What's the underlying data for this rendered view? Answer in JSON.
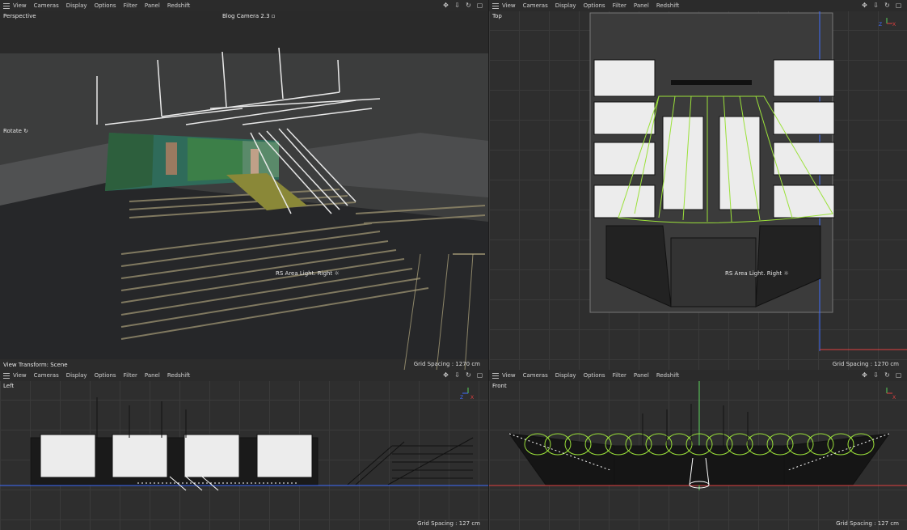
{
  "menu": [
    "View",
    "Cameras",
    "Display",
    "Options",
    "Filter",
    "Panel",
    "Redshift"
  ],
  "nav_icons": [
    "move-icon",
    "pan-icon",
    "rotate-icon",
    "maximize-icon"
  ],
  "axis_labels": {
    "z": "Z",
    "x": "X",
    "y": "Y"
  },
  "viewports": {
    "perspective": {
      "label": "Perspective",
      "camera": "Blog Camera 2.3",
      "rotate": "Rotate",
      "light_label": "RS Area Light. Right",
      "view_transform": "View Transform: Scene",
      "grid_spacing": "Grid Spacing : 1270 cm"
    },
    "top": {
      "label": "Top",
      "light_label": "RS Area Light. Right",
      "grid_spacing": "Grid Spacing : 1270 cm"
    },
    "left": {
      "label": "Left",
      "grid_spacing": "Grid Spacing : 127 cm"
    },
    "front": {
      "label": "Front",
      "grid_spacing": "Grid Spacing : 127 cm"
    }
  },
  "colors": {
    "background": "#262626",
    "wire": "#ffffff",
    "light_green": "#9be13a",
    "axis_x": "#e04040",
    "axis_y": "#5ad15a",
    "axis_z": "#3f6cff"
  }
}
